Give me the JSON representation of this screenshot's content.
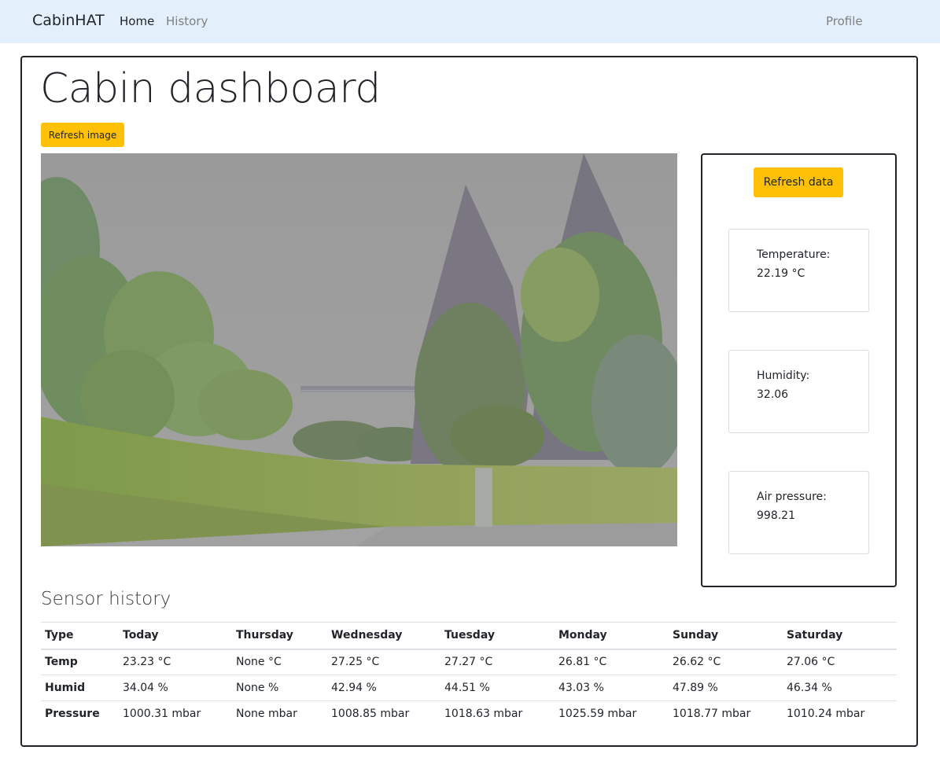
{
  "navbar": {
    "brand": "CabinHAT",
    "links": [
      {
        "label": "Home",
        "active": true
      },
      {
        "label": "History",
        "active": false
      }
    ],
    "profile": "Profile",
    "background": "#e3f0fb"
  },
  "page": {
    "title": "Cabin dashboard",
    "refresh_image_label": "Refresh image"
  },
  "sidebar": {
    "refresh_data_label": "Refresh data",
    "sensors": [
      {
        "label": "Temperature:",
        "value": "22.19 °C"
      },
      {
        "label": "Humidity:",
        "value": "32.06"
      },
      {
        "label": "Air pressure:",
        "value": "998.21"
      }
    ]
  },
  "history": {
    "title": "Sensor history",
    "headers": [
      "Type",
      "Today",
      "Thursday",
      "Wednesday",
      "Tuesday",
      "Monday",
      "Sunday",
      "Saturday"
    ],
    "rows": [
      {
        "type": "Temp",
        "values": [
          "23.23 °C",
          "None °C",
          "27.25 °C",
          "27.27 °C",
          "26.81 °C",
          "26.62 °C",
          "27.06 °C"
        ]
      },
      {
        "type": "Humid",
        "values": [
          "34.04 %",
          "None %",
          "42.94 %",
          "44.51 %",
          "43.03 %",
          "47.89 %",
          "46.34 %"
        ]
      },
      {
        "type": "Pressure",
        "values": [
          "1000.31 mbar",
          "None mbar",
          "1008.85 mbar",
          "1018.63 mbar",
          "1025.59 mbar",
          "1018.77 mbar",
          "1010.24 mbar"
        ]
      }
    ]
  },
  "colors": {
    "accent": "#ffc107",
    "border": "#212529"
  }
}
